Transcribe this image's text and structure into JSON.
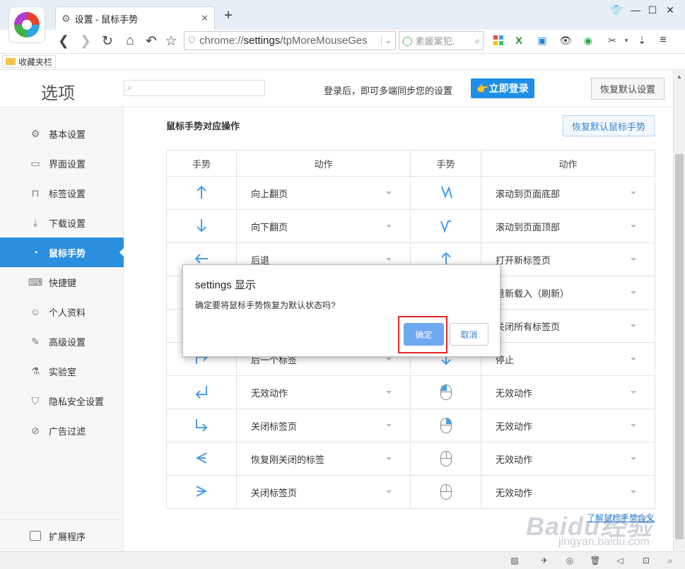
{
  "browser": {
    "tab_title": "设置 - 鼠标手势",
    "address_prefix": "chrome://",
    "address_bold": "settings",
    "address_rest": "/tpMoreMouseGes",
    "search_text": "素媛案犯."
  },
  "bookmarks": {
    "folder_label": "收藏夹栏"
  },
  "header": {
    "title": "选项",
    "login_tip": "登录后，即可多端同步您的设置",
    "login_button": "👉立即登录",
    "restore_default": "恢复默认设置"
  },
  "sidebar": {
    "items": [
      {
        "label": "基本设置",
        "icon": "gear-icon"
      },
      {
        "label": "界面设置",
        "icon": "window-icon"
      },
      {
        "label": "标签设置",
        "icon": "tab-icon"
      },
      {
        "label": "下载设置",
        "icon": "download-icon"
      },
      {
        "label": "鼠标手势",
        "icon": "mouse-icon",
        "active": true
      },
      {
        "label": "快捷键",
        "icon": "keyboard-icon"
      },
      {
        "label": "个人资料",
        "icon": "person-icon"
      },
      {
        "label": "高级设置",
        "icon": "wrench-icon"
      },
      {
        "label": "实验室",
        "icon": "flask-icon"
      },
      {
        "label": "隐私安全设置",
        "icon": "shield-icon"
      },
      {
        "label": "广告过滤",
        "icon": "block-icon"
      }
    ],
    "extensions": "扩展程序"
  },
  "main": {
    "section_title": "鼠标手势对应操作",
    "restore_gesture": "恢复默认鼠标手势",
    "columns": [
      "手势",
      "动作",
      "手势",
      "动作"
    ],
    "rows": [
      {
        "g1": "↑",
        "a1": "向上翻页",
        "g2": "zigzag-down",
        "a2": "滚动到页面底部"
      },
      {
        "g1": "↓",
        "a1": "向下翻页",
        "g2": "zigzag-up",
        "a2": "滚动到页面顶部"
      },
      {
        "g1": "←",
        "a1": "后退",
        "g2": "↑",
        "a2": "打开新标签页"
      },
      {
        "g1": "→",
        "a1": "",
        "g2": "",
        "a2": "重新载入（刷新）"
      },
      {
        "g1": "",
        "a1": "",
        "g2": "",
        "a2": "关闭所有标签页"
      },
      {
        "g1": "↱",
        "a1": "后一个标签",
        "g2": "↓",
        "a2": "停止"
      },
      {
        "g1": "↵",
        "a1": "无效动作",
        "g2": "mouse-left",
        "a2": "无效动作"
      },
      {
        "g1": "↳",
        "a1": "关闭标签页",
        "g2": "mouse-right",
        "a2": "无效动作"
      },
      {
        "g1": "⇐",
        "a1": "恢复刚关闭的标签",
        "g2": "mouse-up",
        "a2": "无效动作"
      },
      {
        "g1": "⇒",
        "a1": "关闭标签页",
        "g2": "mouse-down",
        "a2": "无效动作"
      }
    ],
    "learn_link": "了解鼠标手势含义"
  },
  "dialog": {
    "title": "settings 显示",
    "message": "确定要将鼠标手势恢复为默认状态吗?",
    "ok": "确定",
    "cancel": "取消"
  },
  "watermark": {
    "main": "Baidu经验",
    "sub": "jingyan.baidu.com"
  }
}
